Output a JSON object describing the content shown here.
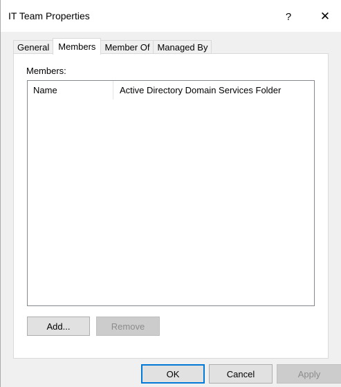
{
  "window": {
    "title": "IT Team Properties",
    "help_glyph": "?",
    "close_glyph": "✕"
  },
  "tabs": [
    {
      "label": "General",
      "active": false
    },
    {
      "label": "Members",
      "active": true
    },
    {
      "label": "Member Of",
      "active": false
    },
    {
      "label": "Managed By",
      "active": false
    }
  ],
  "members": {
    "label": "Members:",
    "columns": [
      "Name",
      "Active Directory Domain Services Folder"
    ],
    "rows": []
  },
  "buttons": {
    "add": "Add...",
    "remove": "Remove",
    "ok": "OK",
    "cancel": "Cancel",
    "apply": "Apply"
  },
  "colors": {
    "default_button_border": "#0078d7",
    "disabled_text": "#8c8c8c"
  }
}
